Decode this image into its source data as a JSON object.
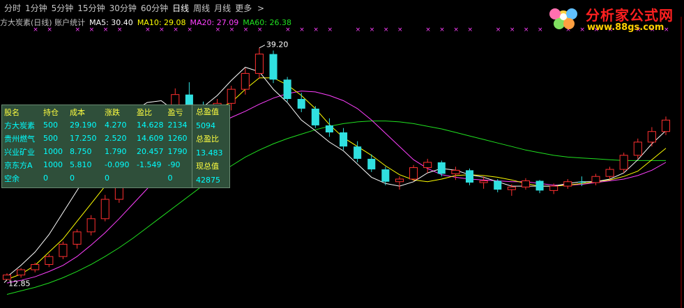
{
  "toolbar": {
    "items": [
      "分时",
      "1分钟",
      "5分钟",
      "15分钟",
      "30分钟",
      "60分钟",
      "日线",
      "周线",
      "月线",
      "更多"
    ],
    "more_chevron": ">",
    "active_index": 6
  },
  "info": {
    "title": "方大炭素(日线) 账户统计",
    "ma5": "MA5: 30.40",
    "ma10": "MA10: 29.08",
    "ma20": "MA20: 27.09",
    "ma60": "MA60: 26.38"
  },
  "logo": {
    "title": "分析家公式网",
    "url": "www.88gs.com"
  },
  "colors": {
    "ma5": "#ffffff",
    "ma10": "#ffff00",
    "ma20": "#ff40ff",
    "ma60": "#20e020",
    "up": "#ff3030",
    "down": "#30e0e0",
    "markers": "#ff40ff"
  },
  "stats": {
    "headers": [
      "股名",
      "持仓",
      "成本",
      "涨跌",
      "盈比",
      "盈亏"
    ],
    "rows": [
      [
        "方大炭素",
        "500",
        "29.190",
        "4.270",
        "14.628",
        "2134"
      ],
      [
        "贵州燃气",
        "500",
        "17.250",
        "2.520",
        "14.609",
        "1260"
      ],
      [
        "兴业矿业",
        "1000",
        "8.750",
        "1.790",
        "20.457",
        "1790"
      ],
      [
        "京东方A",
        "1000",
        "5.810",
        "-0.090",
        "-1.549",
        "-90"
      ],
      [
        "空余",
        "0",
        "0",
        "0",
        "",
        "0"
      ]
    ],
    "summary": [
      {
        "label": "总盈值",
        "value": "5094"
      },
      {
        "label": "总盈比",
        "value": "13.483"
      },
      {
        "label": "现总值",
        "value": "42875"
      }
    ]
  },
  "chart_data": {
    "type": "line",
    "title": "",
    "xlabel": "",
    "ylabel": "",
    "ylim": [
      11,
      41
    ],
    "high_label": "39.20",
    "low_label": "12.85",
    "series": [
      {
        "name": "MA5",
        "values": [
          13.2,
          14.5,
          16,
          18,
          20.5,
          23,
          25.5,
          28,
          30,
          32,
          33,
          33.2,
          32,
          31.5,
          32.5,
          33.8,
          35.5,
          37,
          36.5,
          34.5,
          33,
          31,
          29.8,
          28.5,
          27.5,
          26,
          24.5,
          23.8,
          23.5,
          24,
          25,
          25.5,
          25.3,
          24.8,
          24.5,
          24,
          23.5,
          23.5,
          23.5,
          23.5,
          23.8,
          24,
          24,
          24.3,
          25,
          26.5,
          28.3,
          29.8
        ]
      },
      {
        "name": "MA10",
        "values": [
          12.9,
          13.5,
          14.5,
          16,
          17.5,
          19.5,
          21.5,
          23.5,
          25.5,
          27.5,
          29.5,
          31,
          31.5,
          31.8,
          32,
          32.3,
          33,
          34.5,
          35.8,
          35.8,
          35,
          33.8,
          32.3,
          30.5,
          29,
          28,
          27,
          25.8,
          24.8,
          24.2,
          24,
          24.3,
          24.7,
          24.8,
          24.7,
          24.5,
          24.2,
          23.8,
          23.5,
          23.5,
          23.6,
          23.8,
          24,
          24.2,
          24.6,
          25.2,
          26.5,
          27.8
        ]
      },
      {
        "name": "MA20",
        "values": [
          12.5,
          12.8,
          13.2,
          13.8,
          14.5,
          15.5,
          16.8,
          18.2,
          19.8,
          21.5,
          23.2,
          25,
          26.5,
          28,
          29.5,
          30.5,
          31.3,
          32,
          32.8,
          33.5,
          34,
          34.3,
          34.2,
          33.8,
          33.2,
          32.3,
          31,
          29.5,
          28,
          26.5,
          25.5,
          24.8,
          24.5,
          24.3,
          24.2,
          24.1,
          24,
          24,
          23.8,
          23.6,
          23.6,
          23.7,
          23.9,
          24.1,
          24.3,
          24.7,
          25.3,
          26.2
        ]
      },
      {
        "name": "MA60",
        "values": [
          11.2,
          11.6,
          12,
          12.5,
          13.1,
          13.8,
          14.6,
          15.5,
          16.5,
          17.6,
          18.8,
          20,
          21.2,
          22.4,
          23.6,
          24.8,
          25.8,
          26.8,
          27.6,
          28.3,
          28.9,
          29.4,
          29.9,
          30.3,
          30.6,
          30.8,
          30.9,
          30.9,
          30.8,
          30.6,
          30.3,
          30,
          29.6,
          29.2,
          28.8,
          28.4,
          28,
          27.6,
          27.3,
          27,
          26.8,
          26.7,
          26.6,
          26.5,
          26.4,
          26.4,
          26.4,
          26.4
        ]
      }
    ],
    "ohlc": [
      [
        12.9,
        13.6,
        12.85,
        13.4
      ],
      [
        13.4,
        14.2,
        13.1,
        14
      ],
      [
        14,
        14.8,
        13.7,
        14.6
      ],
      [
        14.6,
        15.8,
        14.3,
        15.5
      ],
      [
        15.5,
        17.2,
        15.2,
        16.9
      ],
      [
        16.9,
        18.6,
        16.4,
        18.3
      ],
      [
        18.3,
        20.2,
        17.9,
        19.8
      ],
      [
        19.8,
        22.5,
        19.5,
        22
      ],
      [
        22,
        24.8,
        21.6,
        24.3
      ],
      [
        24.3,
        27.2,
        24,
        26.6
      ],
      [
        26.6,
        29.8,
        26.1,
        29.3
      ],
      [
        29.3,
        32.6,
        28.6,
        32
      ],
      [
        32,
        34.6,
        31.2,
        33.9
      ],
      [
        33.9,
        35.3,
        31.9,
        32.2
      ],
      [
        32.2,
        33.1,
        30.6,
        31.3
      ],
      [
        31.3,
        33.4,
        30.7,
        32.9
      ],
      [
        32.9,
        34.9,
        32.1,
        34.5
      ],
      [
        34.5,
        36.9,
        33.9,
        36.3
      ],
      [
        36.3,
        39.2,
        35.7,
        38.5
      ],
      [
        38.5,
        38.9,
        35.2,
        35.6
      ],
      [
        35.6,
        35.9,
        33.1,
        33.4
      ],
      [
        33.4,
        34.1,
        31.9,
        32.3
      ],
      [
        32.3,
        32.6,
        30.1,
        30.4
      ],
      [
        30.4,
        31.2,
        29.1,
        29.6
      ],
      [
        29.6,
        30.1,
        27.6,
        28
      ],
      [
        28,
        28.6,
        26.2,
        26.6
      ],
      [
        26.6,
        27.1,
        25.1,
        25.4
      ],
      [
        25.4,
        25.7,
        23.6,
        24
      ],
      [
        24,
        24.6,
        23.1,
        24.3
      ],
      [
        24.3,
        25.9,
        24.1,
        25.6
      ],
      [
        25.6,
        26.6,
        25,
        26.2
      ],
      [
        26.2,
        26.4,
        24.6,
        24.9
      ],
      [
        24.9,
        25.7,
        24.2,
        25.3
      ],
      [
        25.3,
        25.5,
        23.6,
        23.9
      ],
      [
        23.9,
        24.6,
        23.2,
        24.1
      ],
      [
        24.1,
        24.3,
        22.8,
        23.1
      ],
      [
        23.1,
        23.7,
        22.4,
        23.4
      ],
      [
        23.4,
        24.4,
        23.1,
        24.1
      ],
      [
        24.1,
        24.2,
        22.7,
        23
      ],
      [
        23,
        23.8,
        22.6,
        23.5
      ],
      [
        23.5,
        24.3,
        23.2,
        24
      ],
      [
        24,
        24.6,
        23.5,
        23.9
      ],
      [
        23.9,
        24.9,
        23.6,
        24.6
      ],
      [
        24.6,
        25.7,
        24.3,
        25.4
      ],
      [
        25.4,
        27.3,
        25,
        27
      ],
      [
        27,
        28.9,
        26.6,
        28.5
      ],
      [
        28.5,
        30.2,
        28,
        29.7
      ],
      [
        29.7,
        31.4,
        29.3,
        31
      ]
    ],
    "markers_present": true
  }
}
